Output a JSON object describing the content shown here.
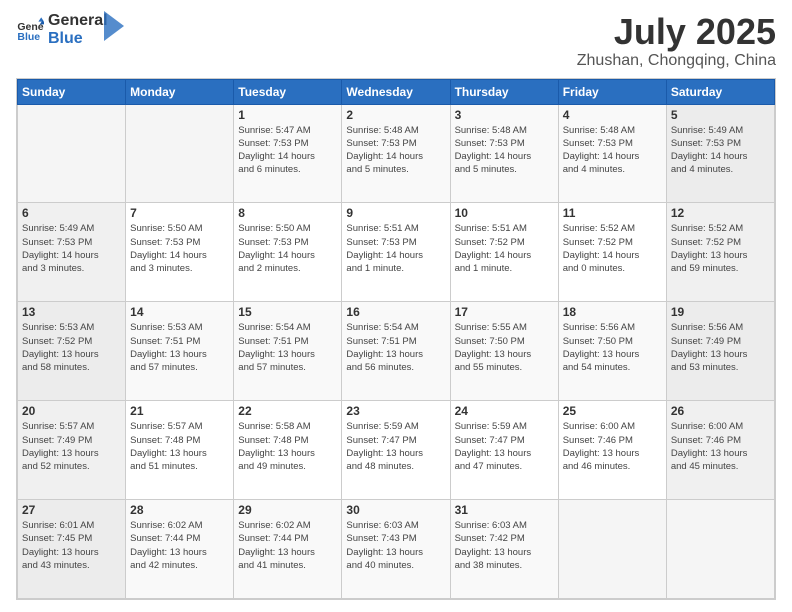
{
  "header": {
    "logo_text_general": "General",
    "logo_text_blue": "Blue",
    "month": "July 2025",
    "location": "Zhushan, Chongqing, China"
  },
  "weekdays": [
    "Sunday",
    "Monday",
    "Tuesday",
    "Wednesday",
    "Thursday",
    "Friday",
    "Saturday"
  ],
  "weeks": [
    [
      {
        "day": "",
        "info": ""
      },
      {
        "day": "",
        "info": ""
      },
      {
        "day": "1",
        "info": "Sunrise: 5:47 AM\nSunset: 7:53 PM\nDaylight: 14 hours\nand 6 minutes."
      },
      {
        "day": "2",
        "info": "Sunrise: 5:48 AM\nSunset: 7:53 PM\nDaylight: 14 hours\nand 5 minutes."
      },
      {
        "day": "3",
        "info": "Sunrise: 5:48 AM\nSunset: 7:53 PM\nDaylight: 14 hours\nand 5 minutes."
      },
      {
        "day": "4",
        "info": "Sunrise: 5:48 AM\nSunset: 7:53 PM\nDaylight: 14 hours\nand 4 minutes."
      },
      {
        "day": "5",
        "info": "Sunrise: 5:49 AM\nSunset: 7:53 PM\nDaylight: 14 hours\nand 4 minutes."
      }
    ],
    [
      {
        "day": "6",
        "info": "Sunrise: 5:49 AM\nSunset: 7:53 PM\nDaylight: 14 hours\nand 3 minutes."
      },
      {
        "day": "7",
        "info": "Sunrise: 5:50 AM\nSunset: 7:53 PM\nDaylight: 14 hours\nand 3 minutes."
      },
      {
        "day": "8",
        "info": "Sunrise: 5:50 AM\nSunset: 7:53 PM\nDaylight: 14 hours\nand 2 minutes."
      },
      {
        "day": "9",
        "info": "Sunrise: 5:51 AM\nSunset: 7:53 PM\nDaylight: 14 hours\nand 1 minute."
      },
      {
        "day": "10",
        "info": "Sunrise: 5:51 AM\nSunset: 7:52 PM\nDaylight: 14 hours\nand 1 minute."
      },
      {
        "day": "11",
        "info": "Sunrise: 5:52 AM\nSunset: 7:52 PM\nDaylight: 14 hours\nand 0 minutes."
      },
      {
        "day": "12",
        "info": "Sunrise: 5:52 AM\nSunset: 7:52 PM\nDaylight: 13 hours\nand 59 minutes."
      }
    ],
    [
      {
        "day": "13",
        "info": "Sunrise: 5:53 AM\nSunset: 7:52 PM\nDaylight: 13 hours\nand 58 minutes."
      },
      {
        "day": "14",
        "info": "Sunrise: 5:53 AM\nSunset: 7:51 PM\nDaylight: 13 hours\nand 57 minutes."
      },
      {
        "day": "15",
        "info": "Sunrise: 5:54 AM\nSunset: 7:51 PM\nDaylight: 13 hours\nand 57 minutes."
      },
      {
        "day": "16",
        "info": "Sunrise: 5:54 AM\nSunset: 7:51 PM\nDaylight: 13 hours\nand 56 minutes."
      },
      {
        "day": "17",
        "info": "Sunrise: 5:55 AM\nSunset: 7:50 PM\nDaylight: 13 hours\nand 55 minutes."
      },
      {
        "day": "18",
        "info": "Sunrise: 5:56 AM\nSunset: 7:50 PM\nDaylight: 13 hours\nand 54 minutes."
      },
      {
        "day": "19",
        "info": "Sunrise: 5:56 AM\nSunset: 7:49 PM\nDaylight: 13 hours\nand 53 minutes."
      }
    ],
    [
      {
        "day": "20",
        "info": "Sunrise: 5:57 AM\nSunset: 7:49 PM\nDaylight: 13 hours\nand 52 minutes."
      },
      {
        "day": "21",
        "info": "Sunrise: 5:57 AM\nSunset: 7:48 PM\nDaylight: 13 hours\nand 51 minutes."
      },
      {
        "day": "22",
        "info": "Sunrise: 5:58 AM\nSunset: 7:48 PM\nDaylight: 13 hours\nand 49 minutes."
      },
      {
        "day": "23",
        "info": "Sunrise: 5:59 AM\nSunset: 7:47 PM\nDaylight: 13 hours\nand 48 minutes."
      },
      {
        "day": "24",
        "info": "Sunrise: 5:59 AM\nSunset: 7:47 PM\nDaylight: 13 hours\nand 47 minutes."
      },
      {
        "day": "25",
        "info": "Sunrise: 6:00 AM\nSunset: 7:46 PM\nDaylight: 13 hours\nand 46 minutes."
      },
      {
        "day": "26",
        "info": "Sunrise: 6:00 AM\nSunset: 7:46 PM\nDaylight: 13 hours\nand 45 minutes."
      }
    ],
    [
      {
        "day": "27",
        "info": "Sunrise: 6:01 AM\nSunset: 7:45 PM\nDaylight: 13 hours\nand 43 minutes."
      },
      {
        "day": "28",
        "info": "Sunrise: 6:02 AM\nSunset: 7:44 PM\nDaylight: 13 hours\nand 42 minutes."
      },
      {
        "day": "29",
        "info": "Sunrise: 6:02 AM\nSunset: 7:44 PM\nDaylight: 13 hours\nand 41 minutes."
      },
      {
        "day": "30",
        "info": "Sunrise: 6:03 AM\nSunset: 7:43 PM\nDaylight: 13 hours\nand 40 minutes."
      },
      {
        "day": "31",
        "info": "Sunrise: 6:03 AM\nSunset: 7:42 PM\nDaylight: 13 hours\nand 38 minutes."
      },
      {
        "day": "",
        "info": ""
      },
      {
        "day": "",
        "info": ""
      }
    ]
  ]
}
